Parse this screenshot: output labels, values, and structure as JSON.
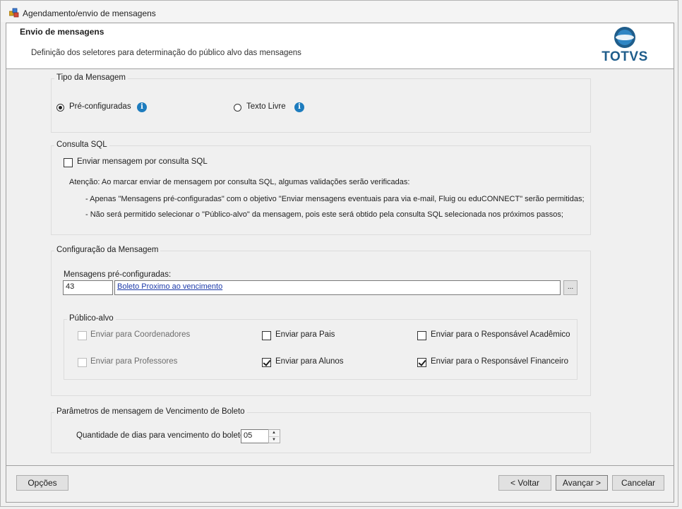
{
  "window": {
    "title": "Agendamento/envio de mensagens"
  },
  "header": {
    "title": "Envio de mensagens",
    "subtitle": "Definição dos seletores para determinação do público alvo das mensagens",
    "logo_text": "TOTVS"
  },
  "tipo_mensagem": {
    "title": "Tipo da Mensagem",
    "options": [
      {
        "label": "Pré-configuradas",
        "selected": true
      },
      {
        "label": "Texto Livre",
        "selected": false
      }
    ],
    "info_glyph": "i"
  },
  "consulta_sql": {
    "title": "Consulta SQL",
    "checkbox_label": "Enviar mensagem por consulta SQL",
    "checked": false,
    "note_title": "Atenção: Ao marcar enviar de mensagem por consulta SQL, algumas validações serão verificadas:",
    "note_line1": "- Apenas \"Mensagens pré-configuradas\" com o objetivo \"Enviar mensagens eventuais para via e-mail, Fluig ou eduCONNECT\" serão permitidas;",
    "note_line2": "- Não será permitido selecionar o \"Público-alvo\" da mensagem, pois este será obtido pela consulta SQL selecionada nos próximos passos;"
  },
  "configuracao": {
    "title": "Configuração da Mensagem",
    "field_label": "Mensagens pré-configuradas:",
    "code": "43",
    "description": "Boleto Proximo ao vencimento",
    "browse_label": "...",
    "publico_alvo": {
      "title": "Público-alvo",
      "items": [
        {
          "label": "Enviar para Coordenadores",
          "checked": false,
          "enabled": false
        },
        {
          "label": "Enviar para Pais",
          "checked": false,
          "enabled": true
        },
        {
          "label": "Enviar para o Responsável Acadêmico",
          "checked": false,
          "enabled": true
        },
        {
          "label": "Enviar para Professores",
          "checked": false,
          "enabled": false
        },
        {
          "label": "Enviar para Alunos",
          "checked": true,
          "enabled": true
        },
        {
          "label": "Enviar para o Responsável Financeiro",
          "checked": true,
          "enabled": true
        }
      ]
    }
  },
  "parametros": {
    "title": "Parâmetros de mensagem de Vencimento de Boleto",
    "label": "Quantidade de dias para vencimento do boleto:",
    "value": "05"
  },
  "footer": {
    "options_label": "Opções",
    "back_label": "< Voltar",
    "next_label": "Avançar >",
    "cancel_label": "Cancelar"
  }
}
